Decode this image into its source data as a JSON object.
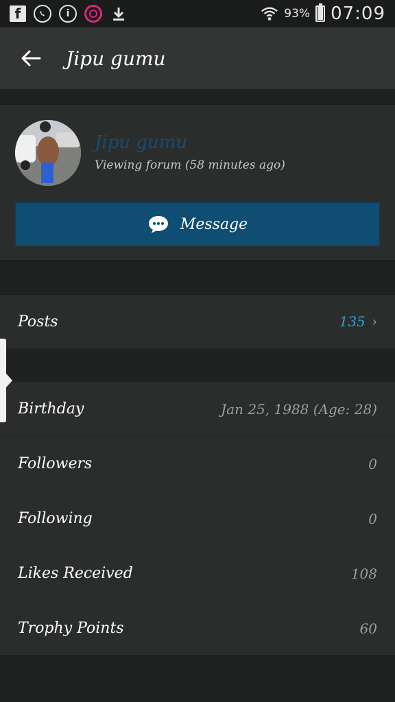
{
  "status_bar": {
    "icons": [
      "facebook-icon",
      "whatsapp-icon",
      "info-icon",
      "fingerprint-icon",
      "download-icon",
      "wifi-icon"
    ],
    "battery": "93%",
    "battery_level": 0.93,
    "time": "07:09"
  },
  "app_bar": {
    "back_icon": "arrow-left-icon",
    "title": "Jipu gumu"
  },
  "profile": {
    "username": "Jipu gumu",
    "status": "Viewing forum (58 minutes ago)",
    "message_label": "Message",
    "message_icon": "chat-bubble-icon"
  },
  "posts": {
    "label": "Posts",
    "value": "135",
    "value_color": "#2aa6d8"
  },
  "details": [
    {
      "label": "Birthday",
      "value": "Jan 25, 1988 (Age: 28)"
    },
    {
      "label": "Followers",
      "value": "0"
    },
    {
      "label": "Following",
      "value": "0"
    },
    {
      "label": "Likes Received",
      "value": "108"
    },
    {
      "label": "Trophy Points",
      "value": "60"
    }
  ],
  "colors": {
    "accent_blue": "#0f4e72",
    "username_blue": "#134e74",
    "background": "#1f2121",
    "card": "#2b2d2d"
  }
}
